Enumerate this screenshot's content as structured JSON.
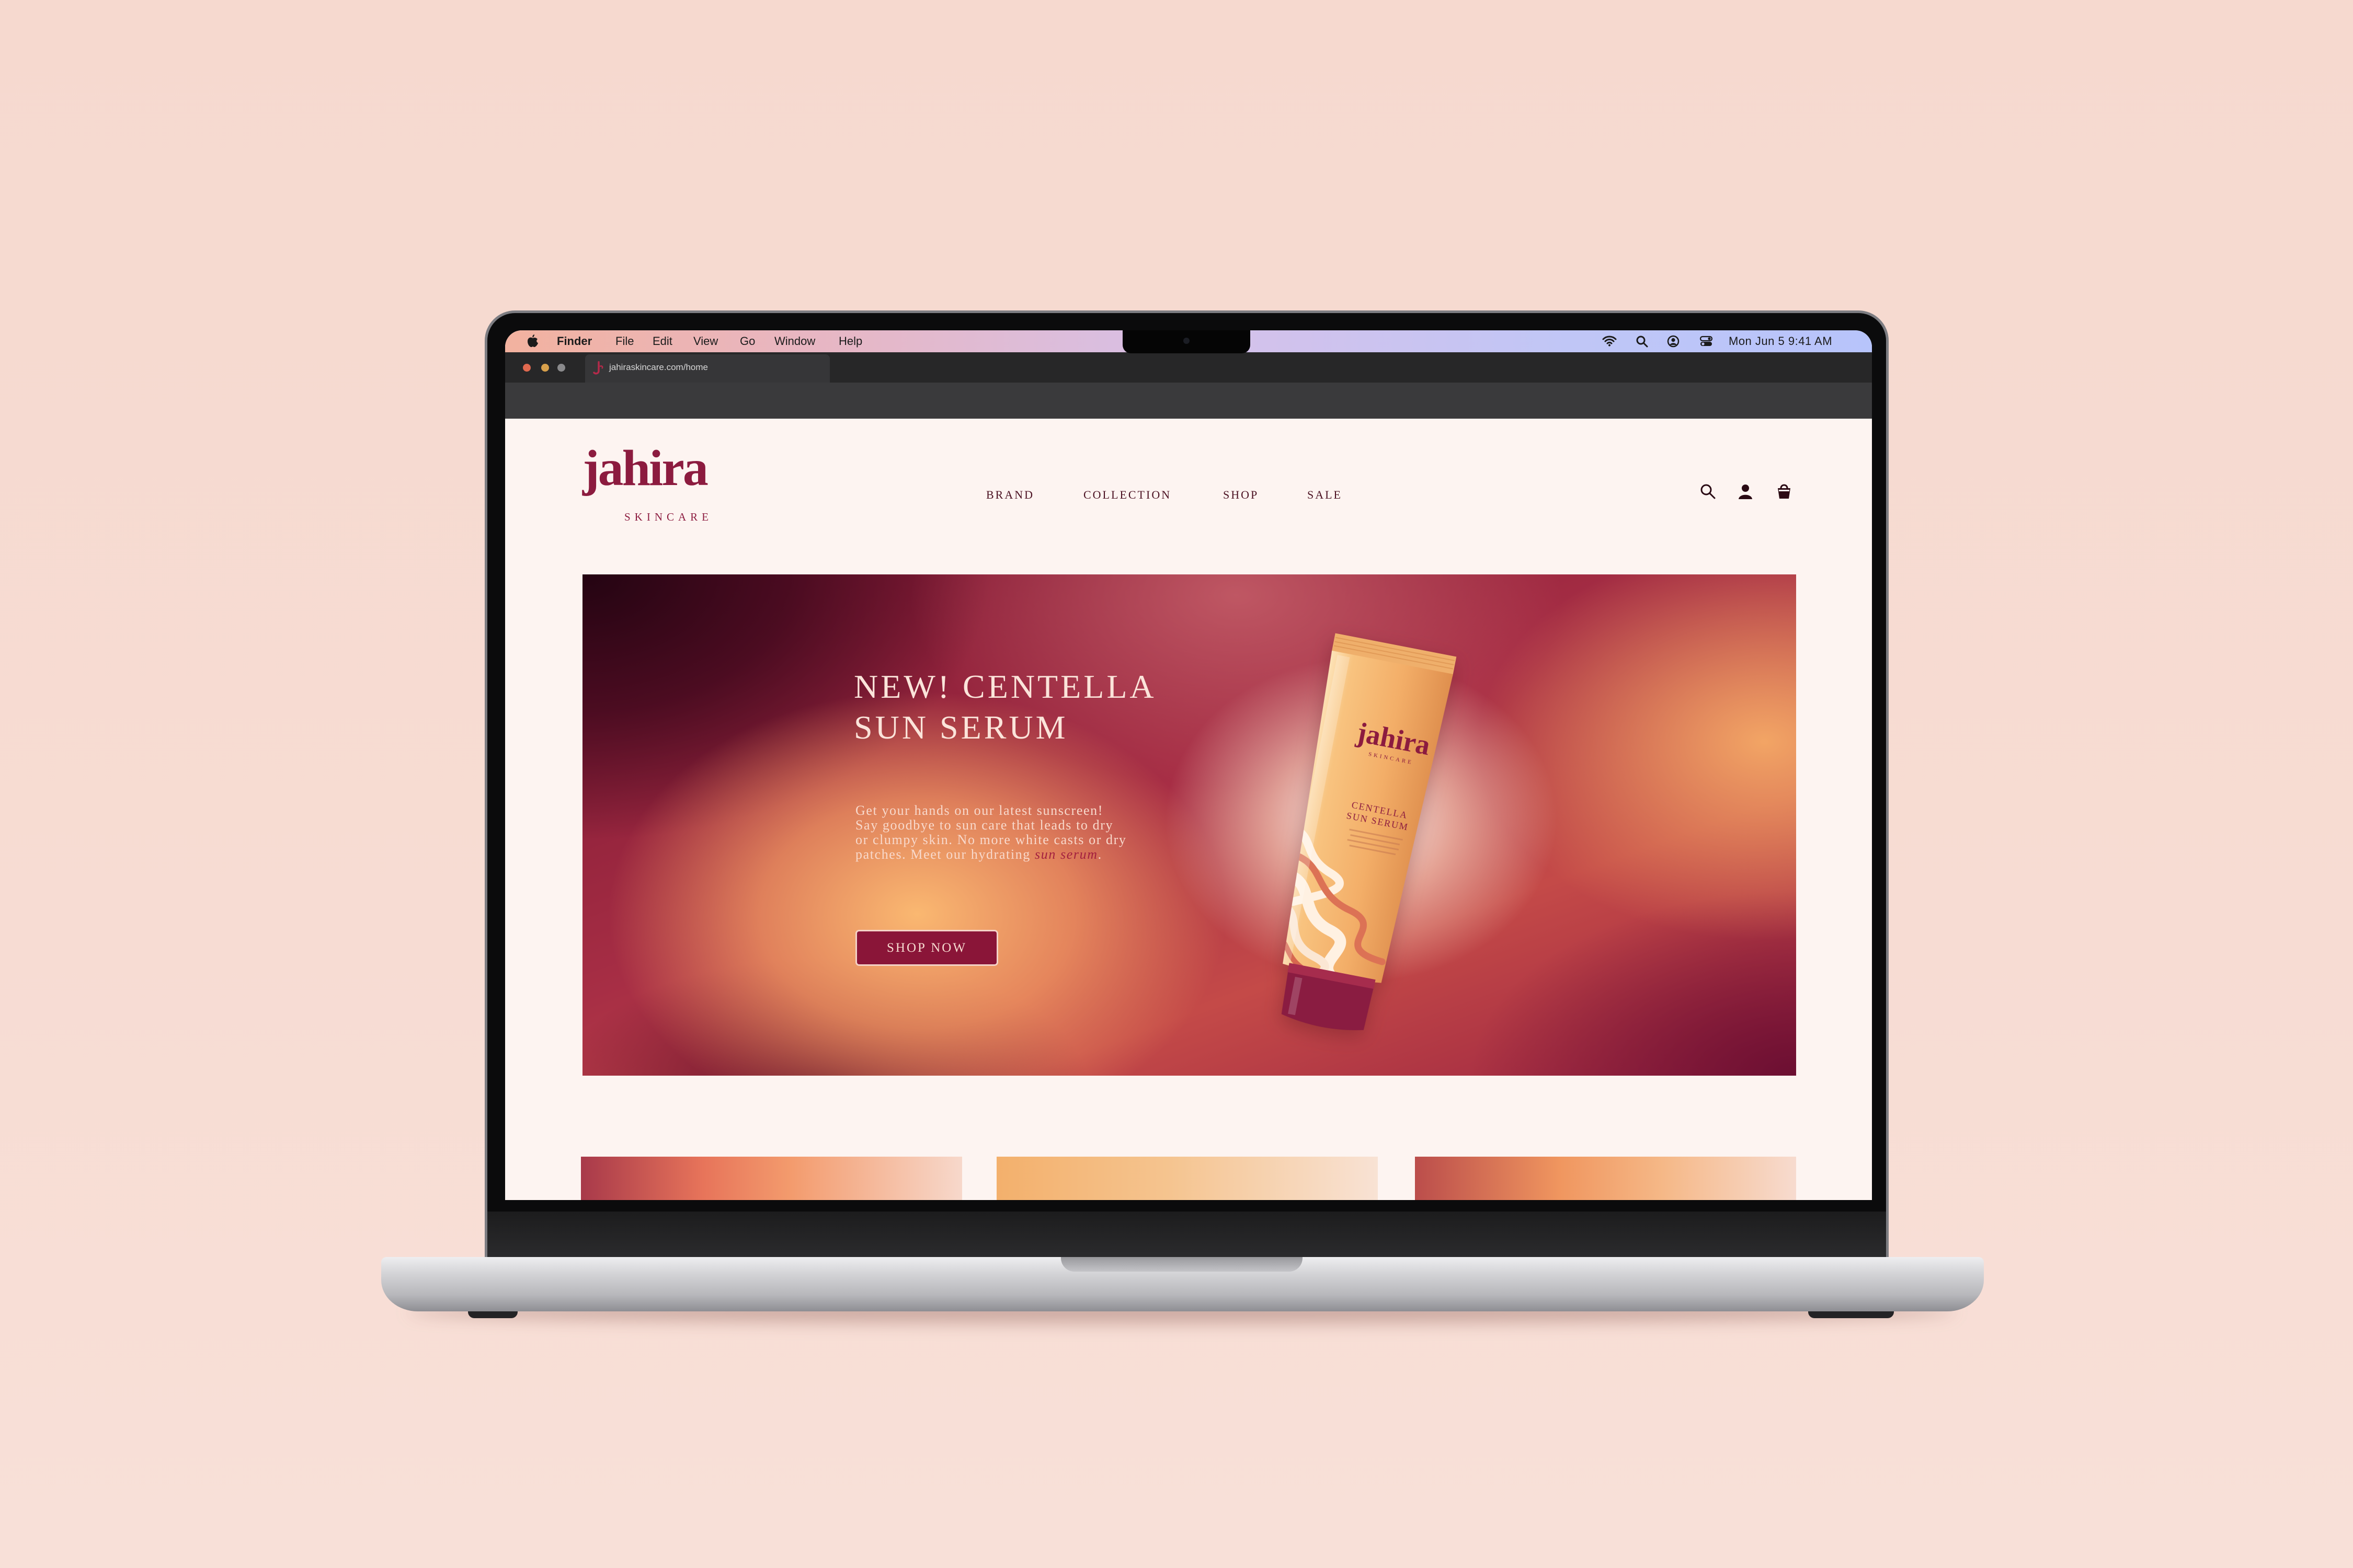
{
  "menubar": {
    "app": "Finder",
    "items": [
      "File",
      "Edit",
      "View",
      "Go",
      "Window",
      "Help"
    ],
    "clock": "Mon Jun 5  9:41 AM"
  },
  "browser": {
    "url": "jahiraskincare.com/home"
  },
  "site": {
    "logo": "jahira",
    "logo_sub": "SKINCARE",
    "nav": [
      "BRAND",
      "COLLECTION",
      "SHOP",
      "SALE"
    ]
  },
  "hero": {
    "headline_1": "NEW! CENTELLA",
    "headline_2": "SUN SERUM",
    "body_lines": [
      "Get your hands on our latest sunscreen!",
      "Say goodbye to sun care that leads to dry",
      "or clumpy skin. No more white casts or dry"
    ],
    "body_last": "patches. Meet our hydrating ",
    "body_highlight": "sun serum",
    "body_end": ".",
    "cta": "SHOP NOW"
  },
  "product": {
    "brand": "jahira",
    "brand_sub": "SKINCARE",
    "name_1": "CENTELLA",
    "name_2": "SUN SERUM"
  },
  "icons": {
    "menubar": [
      "apple-icon",
      "wifi-icon",
      "spotlight-icon",
      "user-icon",
      "control-center-icon"
    ],
    "header": [
      "search-icon",
      "account-icon",
      "bag-icon"
    ]
  },
  "colors": {
    "brand": "#8c1b3f",
    "page_background": "#fdf4f1",
    "scene_background": "#f6d9cf",
    "cta_background": "#8a1538"
  }
}
